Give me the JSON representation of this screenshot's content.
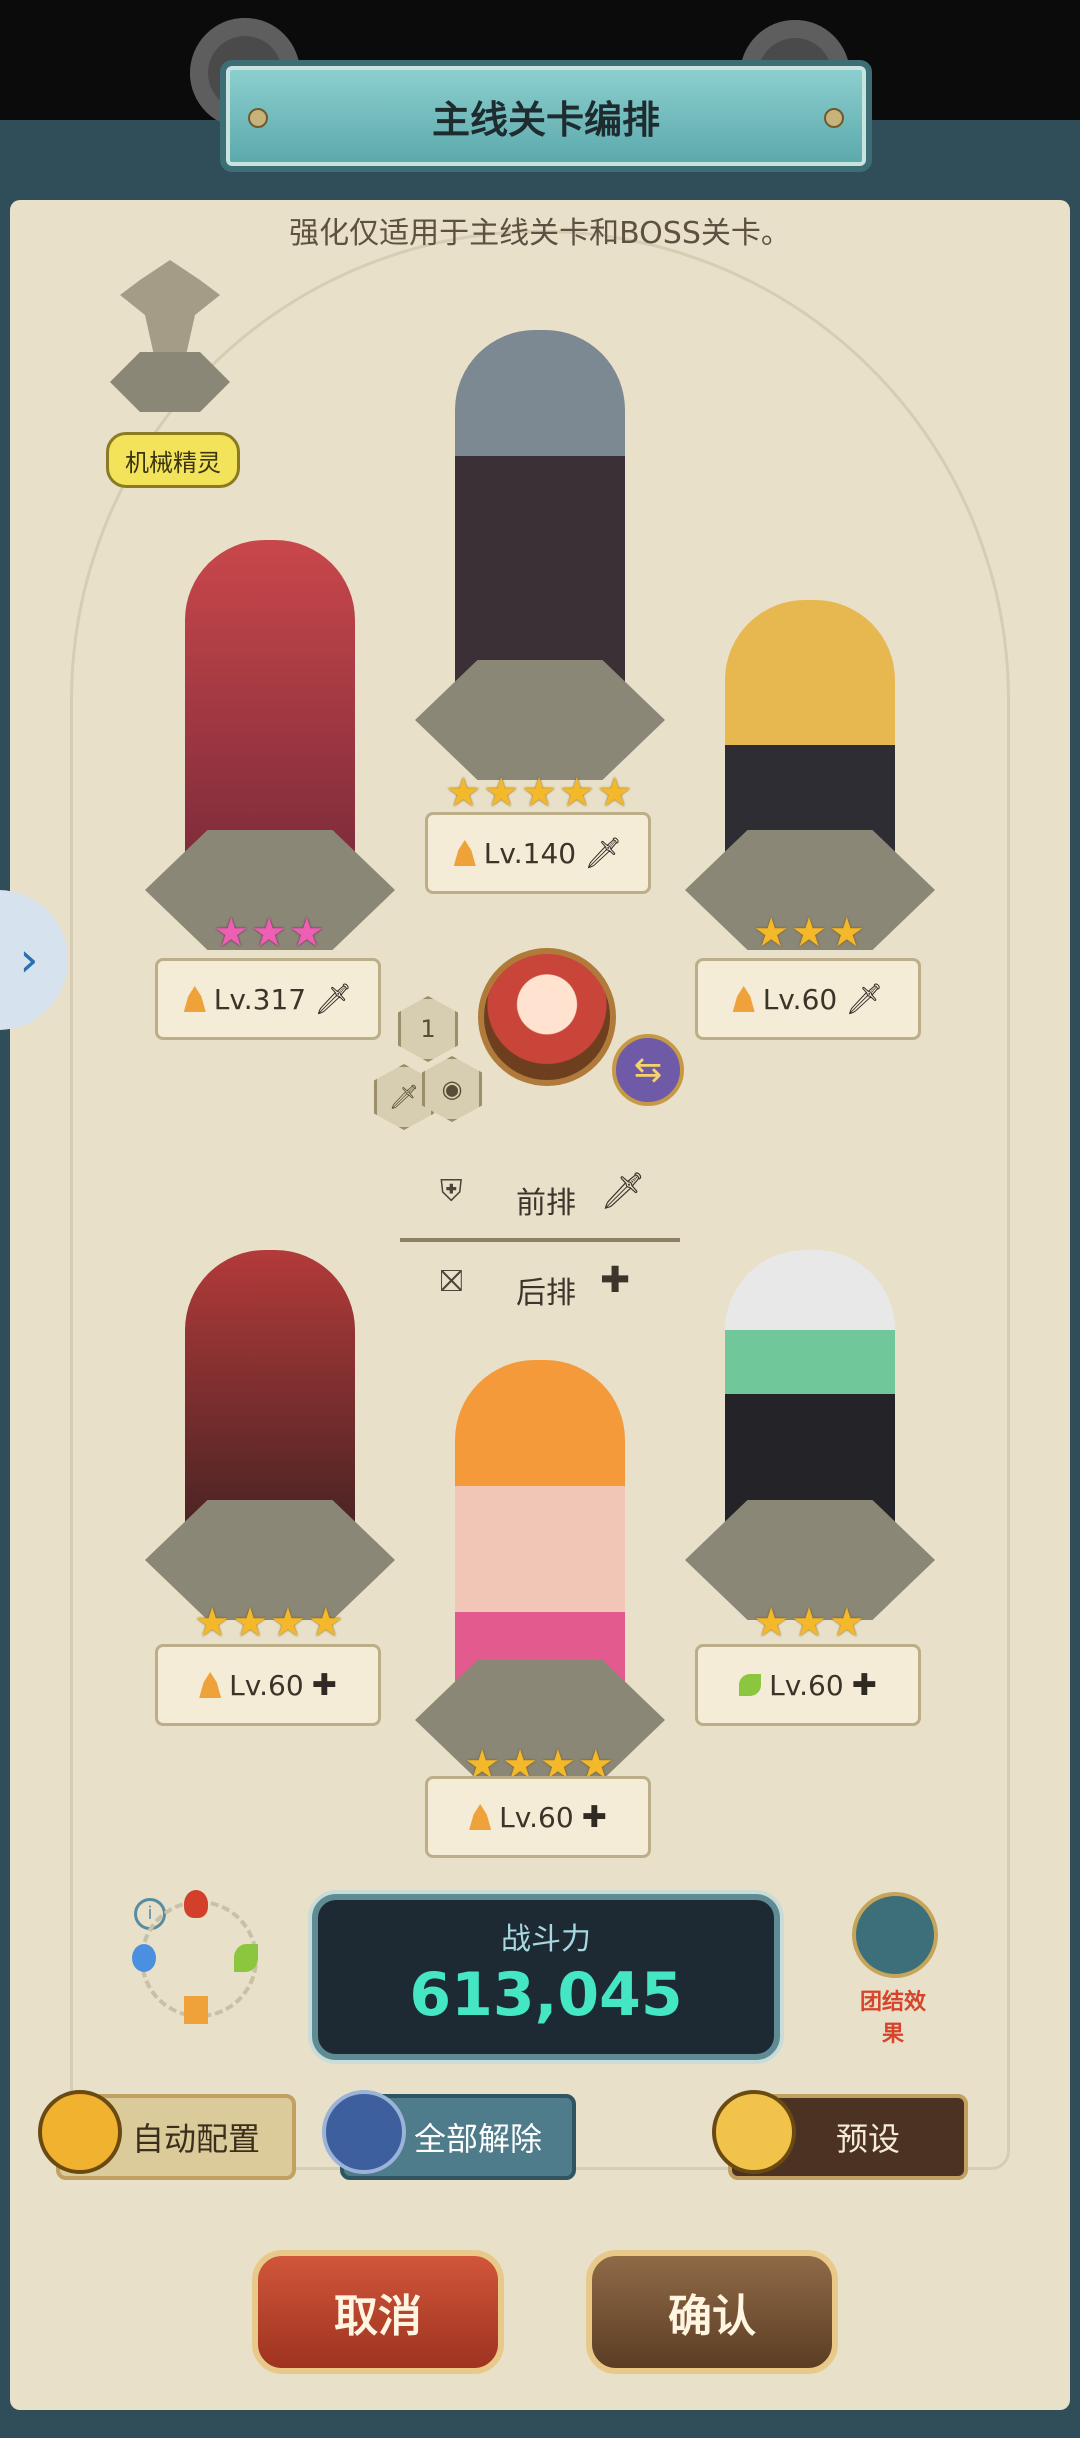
{
  "title": "主线关卡编排",
  "subtitle": "强化仅适用于主线关卡和BOSS关卡。",
  "spirit_label": "机械精灵",
  "center": {
    "badge_number": "1"
  },
  "rows": {
    "front": "前排",
    "back": "后排"
  },
  "slots": [
    {
      "id": "top",
      "level": "Lv.140",
      "stars": "★★★★★",
      "star_color": "gold",
      "element": "fire"
    },
    {
      "id": "upper-left",
      "level": "Lv.317",
      "stars": "★★★",
      "star_color": "pink",
      "element": "fire"
    },
    {
      "id": "upper-right",
      "level": "Lv.60",
      "stars": "★★★",
      "star_color": "gold",
      "element": "fire"
    },
    {
      "id": "lower-left",
      "level": "Lv.60",
      "stars": "★★★★",
      "star_color": "gold",
      "element": "fire"
    },
    {
      "id": "lower-right",
      "level": "Lv.60",
      "stars": "★★★",
      "star_color": "gold",
      "element": "wind"
    },
    {
      "id": "bottom",
      "level": "Lv.60",
      "stars": "★★★★",
      "star_color": "gold",
      "element": "fire"
    }
  ],
  "power": {
    "label": "战斗力",
    "value": "613,045"
  },
  "team_effect": "团结效果",
  "buttons": {
    "auto": "自动配置",
    "release": "全部解除",
    "preset": "预设",
    "cancel": "取消",
    "confirm": "确认"
  },
  "colors": {
    "power_value": "#45e6c4",
    "title_plate": "#5aa8ab",
    "cancel": "#b8452c",
    "confirm": "#6f4d31"
  }
}
